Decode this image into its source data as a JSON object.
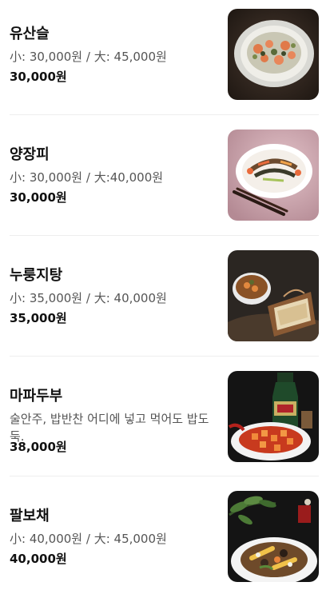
{
  "menu": {
    "items": [
      {
        "name": "유산슬",
        "description": "小: 30,000원 / 大: 45,000원",
        "price": "30,000원",
        "image": "seafood-stirfry-photo"
      },
      {
        "name": "양장피",
        "description": "小: 30,000원 / 大:40,000원",
        "price": "30,000원",
        "image": "cold-platter-photo"
      },
      {
        "name": "누룽지탕",
        "description": "小: 35,000원 / 大: 40,000원",
        "price": "35,000원",
        "image": "crispy-rice-soup-photo"
      },
      {
        "name": "마파두부",
        "description": "술안주, 밥반찬 어디에 넣고 먹어도 밥도둑.",
        "price": "38,000원",
        "image": "mapo-tofu-photo"
      },
      {
        "name": "팔보채",
        "description": "小: 40,000원 / 大: 45,000원",
        "price": "40,000원",
        "image": "eight-treasure-stirfry-photo"
      }
    ]
  }
}
